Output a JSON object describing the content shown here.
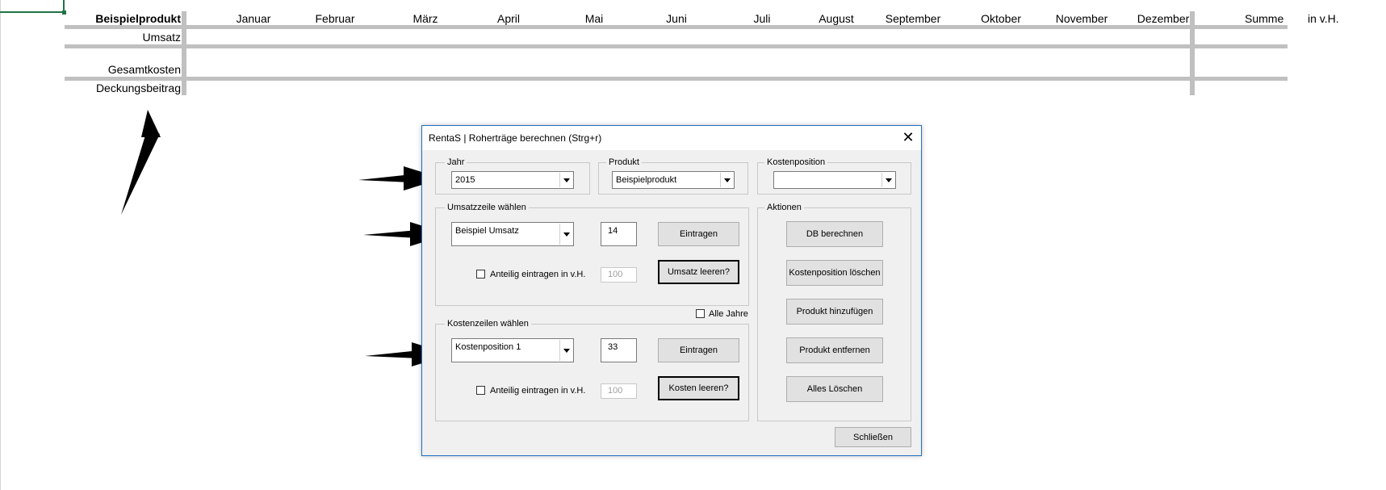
{
  "sheet": {
    "product_header": "Beispielprodukt",
    "months": [
      "Januar",
      "Februar",
      "März",
      "April",
      "Mai",
      "Juni",
      "Juli",
      "August",
      "September",
      "Oktober",
      "November",
      "Dezember"
    ],
    "sum_label": "Summe",
    "percent_label": "in v.H.",
    "rows": [
      "Umsatz",
      "Gesamtkosten",
      "Deckungsbeitrag"
    ]
  },
  "dialog": {
    "title": "RentaS | Roherträge berechnen (Strg+r)",
    "close": "✕",
    "year": {
      "label": "Jahr",
      "value": "2015"
    },
    "product": {
      "label": "Produkt",
      "value": "Beispielprodukt"
    },
    "cost_position": {
      "label": "Kostenposition",
      "value": ""
    },
    "revenue": {
      "label": "Umsatzzeile wählen",
      "combo_value": "Beispiel Umsatz",
      "row_value": "14",
      "enter_button": "Eintragen",
      "clear_button": "Umsatz leeren?",
      "proportional_label": "Anteilig eintragen in v.H.",
      "proportional_value": "100"
    },
    "all_years_label": "Alle Jahre",
    "costs": {
      "label": "Kostenzeilen wählen",
      "combo_value": "Kostenposition 1",
      "row_value": "33",
      "enter_button": "Eintragen",
      "clear_button": "Kosten leeren?",
      "proportional_label": "Anteilig eintragen in v.H.",
      "proportional_value": "100"
    },
    "actions": {
      "label": "Aktionen",
      "buttons": [
        "DB berechnen",
        "Kostenposition löschen",
        "Produkt hinzufügen",
        "Produkt entfernen",
        "Alles Löschen"
      ]
    },
    "close_button": "Schließen"
  },
  "colors": {
    "accent_border": "#1e6fc5",
    "excel_green": "#217346"
  }
}
